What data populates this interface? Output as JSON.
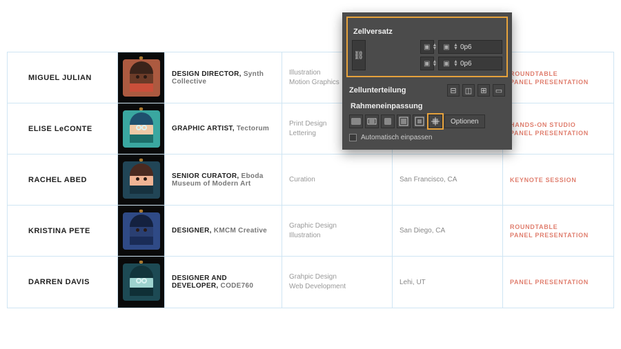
{
  "rows": [
    {
      "name": "MIGUEL JULIAN",
      "role": "DESIGN DIRECTOR,",
      "org": "Synth Collective",
      "skills": [
        "Illustration",
        "Motion Graphics"
      ],
      "location": "",
      "tags": [
        "ROUNDTABLE",
        "PANEL PRESENTATION"
      ],
      "avatar": {
        "bg": "#ac5a40",
        "skin": "#6b3b28",
        "hair": "#3a231a",
        "shirt": "#c94f3a"
      }
    },
    {
      "name": "ELISE LeCONTE",
      "role": "GRAPHIC ARTIST,",
      "org": "Tectorum",
      "skills": [
        "Print Design",
        "Lettering"
      ],
      "location": "",
      "tags": [
        "HANDS-ON STUDIO",
        "PANEL PRESENTATION"
      ],
      "avatar": {
        "bg": "#3aa7a0",
        "skin": "#efc9a6",
        "hair": "#1f506e",
        "shirt": "#1d6f6a",
        "glasses": true
      }
    },
    {
      "name": "RACHEL ABED",
      "role": "SENIOR CURATOR,",
      "org": "Eboda Museum of Modern Art",
      "skills": [
        "Curation"
      ],
      "location": "San Francisco, CA",
      "tags": [
        "KEYNOTE SESSION"
      ],
      "avatar": {
        "bg": "#214556",
        "skin": "#f0b494",
        "hair": "#4a2a20",
        "shirt": "#17323f"
      }
    },
    {
      "name": "KRISTINA PETE",
      "role": "DESIGNER,",
      "org": "KMCM Creative",
      "skills": [
        "Graphic Design",
        "Illustration"
      ],
      "location": "San Diego, CA",
      "tags": [
        "ROUNDTABLE",
        "PANEL PRESENTATION"
      ],
      "avatar": {
        "bg": "#2f4a86",
        "skin": "#2a3f72",
        "hair": "#14213f",
        "shirt": "#1a2c57"
      }
    },
    {
      "name": "DARREN DAVIS",
      "role": "DESIGNER AND DEVELOPER,",
      "org": "CODE760",
      "skills": [
        "Grahpic Design",
        "Web Development"
      ],
      "location": "Lehi, UT",
      "tags": [
        "PANEL PRESENTATION"
      ],
      "avatar": {
        "bg": "#1d4a54",
        "skin": "#9ed3cf",
        "hair": "#12343b",
        "shirt": "#0f2f36",
        "glasses": true
      }
    }
  ],
  "panel": {
    "sect_inset": "Zellversatz",
    "inset_value": "0p6",
    "sect_divisions": "Zellunterteilung",
    "sect_fitting": "Rahmeneinpassung",
    "options_label": "Optionen",
    "auto_fit_label": "Automatisch einpassen"
  }
}
